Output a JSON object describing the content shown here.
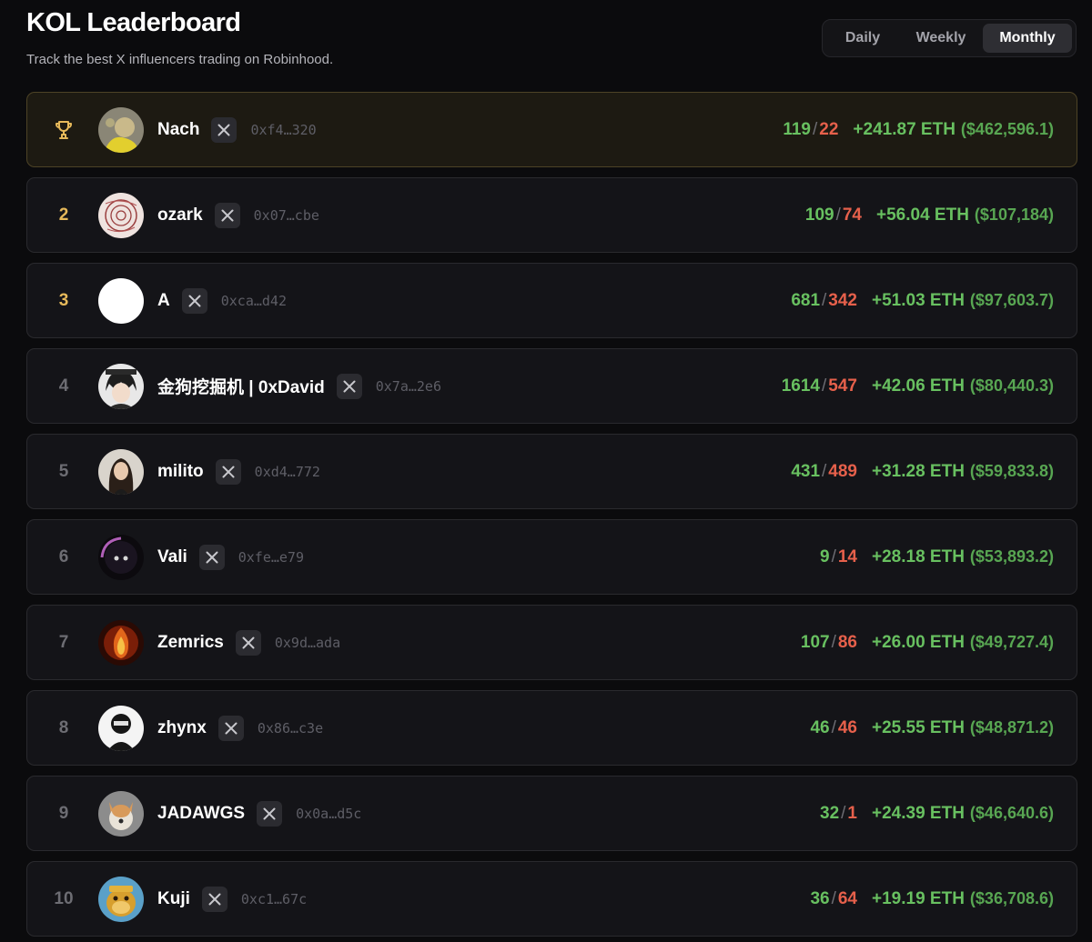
{
  "header": {
    "title": "KOL Leaderboard",
    "subtitle": "Track the best X influencers trading on Robinhood."
  },
  "period_tabs": [
    {
      "label": "Daily",
      "active": false
    },
    {
      "label": "Weekly",
      "active": false
    },
    {
      "label": "Monthly",
      "active": true
    }
  ],
  "leaderboard": [
    {
      "rank": "1",
      "rank_icon": "trophy-icon",
      "name": "Nach",
      "address": "0xf4…320",
      "wins": "119",
      "losses": "22",
      "pnl": "+241.87 ETH",
      "usd": "($462,596.1)",
      "avatar_icon": "avatar-yellow-character-icon"
    },
    {
      "rank": "2",
      "name": "ozark",
      "address": "0x07…cbe",
      "wins": "109",
      "losses": "74",
      "pnl": "+56.04 ETH",
      "usd": "($107,184)",
      "avatar_icon": "avatar-red-sketch-icon"
    },
    {
      "rank": "3",
      "name": "A",
      "address": "0xca…d42",
      "wins": "681",
      "losses": "342",
      "pnl": "+51.03 ETH",
      "usd": "($97,603.7)",
      "avatar_icon": "avatar-white-circle-icon"
    },
    {
      "rank": "4",
      "name": "金狗挖掘机 | 0xDavid",
      "address": "0x7a…2e6",
      "wins": "1614",
      "losses": "547",
      "pnl": "+42.06 ETH",
      "usd": "($80,440.3)",
      "avatar_icon": "avatar-anime-character-icon"
    },
    {
      "rank": "5",
      "name": "milito",
      "address": "0xd4…772",
      "wins": "431",
      "losses": "489",
      "pnl": "+31.28 ETH",
      "usd": "($59,833.8)",
      "avatar_icon": "avatar-portrait-icon"
    },
    {
      "rank": "6",
      "name": "Vali",
      "address": "0xfe…e79",
      "wins": "9",
      "losses": "14",
      "pnl": "+28.18 ETH",
      "usd": "($53,893.2)",
      "avatar_icon": "avatar-dark-figure-icon"
    },
    {
      "rank": "7",
      "name": "Zemrics",
      "address": "0x9d…ada",
      "wins": "107",
      "losses": "86",
      "pnl": "+26.00 ETH",
      "usd": "($49,727.4)",
      "avatar_icon": "avatar-fire-icon"
    },
    {
      "rank": "8",
      "name": "zhynx",
      "address": "0x86…c3e",
      "wins": "46",
      "losses": "46",
      "pnl": "+25.55 ETH",
      "usd": "($48,871.2)",
      "avatar_icon": "avatar-masked-figure-icon"
    },
    {
      "rank": "9",
      "name": "JADAWGS",
      "address": "0x0a…d5c",
      "wins": "32",
      "losses": "1",
      "pnl": "+24.39 ETH",
      "usd": "($46,640.6)",
      "avatar_icon": "avatar-dog-icon"
    },
    {
      "rank": "10",
      "name": "Kuji",
      "address": "0xc1…67c",
      "wins": "36",
      "losses": "64",
      "pnl": "+19.19 ETH",
      "usd": "($36,708.6)",
      "avatar_icon": "avatar-ape-icon"
    }
  ],
  "colors": {
    "background": "#0b0b0d",
    "row_background": "#141418",
    "highlight_row": "#1d1a12",
    "gold": "#e6b95a",
    "positive": "#68c060",
    "negative": "#e6604b"
  }
}
